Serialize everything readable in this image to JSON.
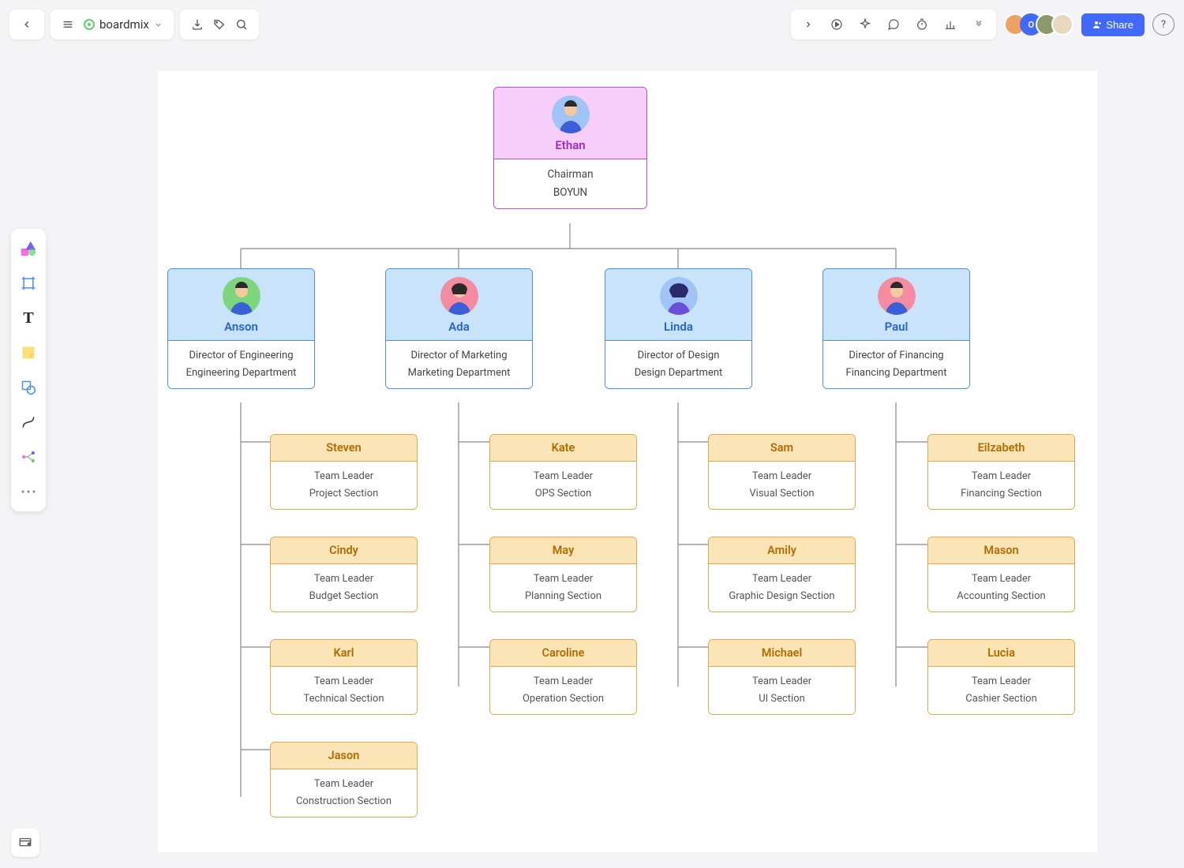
{
  "app": {
    "brand": "boardmix"
  },
  "share": {
    "label": "Share"
  },
  "chart": {
    "ceo": {
      "name": "Ethan",
      "title": "Chairman",
      "org": "BOYUN"
    },
    "directors": [
      {
        "name": "Anson",
        "title": "Director of Engineering",
        "dept": "Engineering Department",
        "teams": [
          {
            "name": "Steven",
            "title": "Team Leader",
            "section": "Project Section"
          },
          {
            "name": "Cindy",
            "title": "Team Leader",
            "section": "Budget Section"
          },
          {
            "name": "Karl",
            "title": "Team Leader",
            "section": "Technical Section"
          },
          {
            "name": "Jason",
            "title": "Team Leader",
            "section": "Construction Section"
          }
        ]
      },
      {
        "name": "Ada",
        "title": "Director of Marketing",
        "dept": "Marketing Department",
        "teams": [
          {
            "name": "Kate",
            "title": "Team Leader",
            "section": "OPS Section"
          },
          {
            "name": "May",
            "title": "Team Leader",
            "section": "Planning Section"
          },
          {
            "name": "Caroline",
            "title": "Team Leader",
            "section": "Operation Section"
          }
        ]
      },
      {
        "name": "Linda",
        "title": "Director of Design",
        "dept": "Design Department",
        "teams": [
          {
            "name": "Sam",
            "title": "Team Leader",
            "section": "Visual Section"
          },
          {
            "name": "Amily",
            "title": "Team Leader",
            "section": "Graphic Design Section"
          },
          {
            "name": "Michael",
            "title": "Team Leader",
            "section": "UI Section"
          }
        ]
      },
      {
        "name": "Paul",
        "title": "Director of Financing",
        "dept": "Financing Department",
        "teams": [
          {
            "name": "Eilzabeth",
            "title": "Team Leader",
            "section": "Financing Section"
          },
          {
            "name": "Mason",
            "title": "Team Leader",
            "section": "Accounting Section"
          },
          {
            "name": "Lucia",
            "title": "Team Leader",
            "section": "Cashier Section"
          }
        ]
      }
    ]
  }
}
